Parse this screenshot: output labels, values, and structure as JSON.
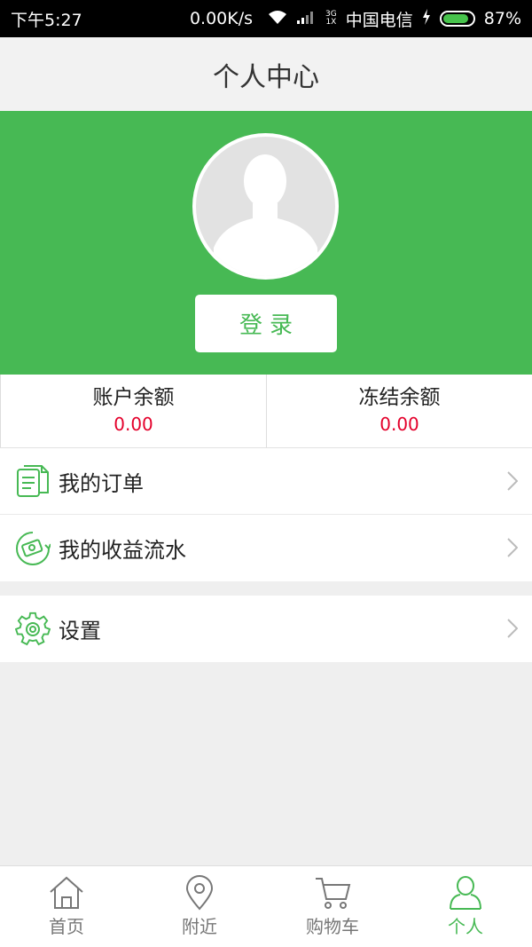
{
  "status_bar": {
    "time": "下午5:27",
    "speed": "0.00K/s",
    "network_type_top": "3G",
    "network_type_bottom": "1X",
    "carrier": "中国电信",
    "battery": "87%",
    "battery_level": 0.87
  },
  "header": {
    "title": "个人中心"
  },
  "profile": {
    "login_label": "登录"
  },
  "balances": [
    {
      "label": "账户余额",
      "value": "0.00"
    },
    {
      "label": "冻结余额",
      "value": "0.00"
    }
  ],
  "menu": {
    "orders": {
      "label": "我的订单",
      "icon": "document-icon"
    },
    "earnings": {
      "label": "我的收益流水",
      "icon": "money-icon"
    },
    "settings": {
      "label": "设置",
      "icon": "gear-icon"
    }
  },
  "tabs": [
    {
      "label": "首页",
      "icon": "home-icon",
      "active": false
    },
    {
      "label": "附近",
      "icon": "location-pin-icon",
      "active": false
    },
    {
      "label": "购物车",
      "icon": "cart-icon",
      "active": false
    },
    {
      "label": "个人",
      "icon": "person-icon",
      "active": true
    }
  ],
  "colors": {
    "accent": "#47b954",
    "value_red": "#e4002b"
  }
}
